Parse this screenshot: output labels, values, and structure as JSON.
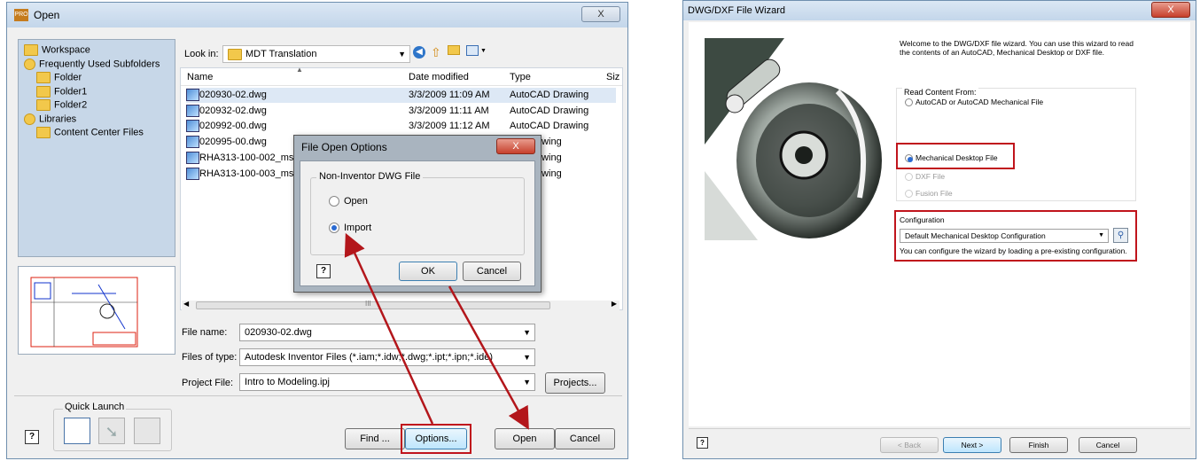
{
  "open_dialog": {
    "title": "Open",
    "close": "X",
    "locations": [
      {
        "label": "Workspace",
        "level": 0,
        "icon": "folder-icon"
      },
      {
        "label": "Frequently Used Subfolders",
        "level": 0,
        "icon": "subfolders-icon"
      },
      {
        "label": "Folder",
        "level": 1,
        "icon": "folder-icon"
      },
      {
        "label": "Folder1",
        "level": 1,
        "icon": "folder-icon"
      },
      {
        "label": "Folder2",
        "level": 1,
        "icon": "folder-icon"
      },
      {
        "label": "Libraries",
        "level": 0,
        "icon": "libraries-icon"
      },
      {
        "label": "Content Center Files",
        "level": 1,
        "icon": "folder-icon"
      }
    ],
    "look_in_label": "Look in:",
    "look_in_value": "MDT Translation",
    "columns": {
      "name": "Name",
      "date": "Date modified",
      "type": "Type",
      "size": "Siz"
    },
    "files": [
      {
        "name": "020930-02.dwg",
        "date": "3/3/2009 11:09 AM",
        "type": "AutoCAD Drawing"
      },
      {
        "name": "020932-02.dwg",
        "date": "3/3/2009 11:11 AM",
        "type": "AutoCAD Drawing"
      },
      {
        "name": "020992-00.dwg",
        "date": "3/3/2009 11:12 AM",
        "type": "AutoCAD Drawing"
      },
      {
        "name": "020995-00.dwg",
        "date": "",
        "type": "AD Drawing"
      },
      {
        "name": "RHA313-100-002_msh",
        "date": "",
        "type": "AD Drawing"
      },
      {
        "name": "RHA313-100-003_msh",
        "date": "",
        "type": "AD Drawing"
      }
    ],
    "scroll_mark": "III",
    "file_name_label": "File name:",
    "file_name_value": "020930-02.dwg",
    "files_of_type_label": "Files of type:",
    "files_of_type_value": "Autodesk Inventor Files (*.iam;*.idw;*.dwg;*.ipt;*.ipn;*.ide)",
    "project_file_label": "Project File:",
    "project_file_value": "Intro to Modeling.ipj",
    "projects_button": "Projects...",
    "quick_launch_label": "Quick Launch",
    "find_button": "Find ...",
    "options_button": "Options...",
    "open_button": "Open",
    "cancel_button": "Cancel",
    "help": "?"
  },
  "options_dialog": {
    "title": "File Open Options",
    "close": "X",
    "group_label": "Non-Inventor DWG File",
    "open_option": "Open",
    "import_option": "Import",
    "selected": "Import",
    "ok_button": "OK",
    "cancel_button": "Cancel",
    "help": "?"
  },
  "wizard": {
    "title": "DWG/DXF File Wizard",
    "close": "X",
    "welcome_text": "Welcome to the DWG/DXF file wizard. You can use this wizard to read the contents of an AutoCAD, Mechanical Desktop or DXF file.",
    "read_content_label": "Read Content From:",
    "options": [
      "AutoCAD or AutoCAD Mechanical File",
      "Mechanical Desktop File",
      "DXF File",
      "Fusion File"
    ],
    "selected": "Mechanical Desktop File",
    "configuration_label": "Configuration",
    "configuration_value": "Default Mechanical Desktop Configuration",
    "configuration_hint": "You can configure the wizard by loading a pre-existing configuration.",
    "back_button": "< Back",
    "next_button": "Next >",
    "finish_button": "Finish",
    "cancel_button": "Cancel",
    "help": "?"
  },
  "colors": {
    "highlight": "#c0141c",
    "title_bar": "#c3d6ea",
    "sidebar": "#c7d7e8",
    "selected_row": "#dde8f5"
  }
}
